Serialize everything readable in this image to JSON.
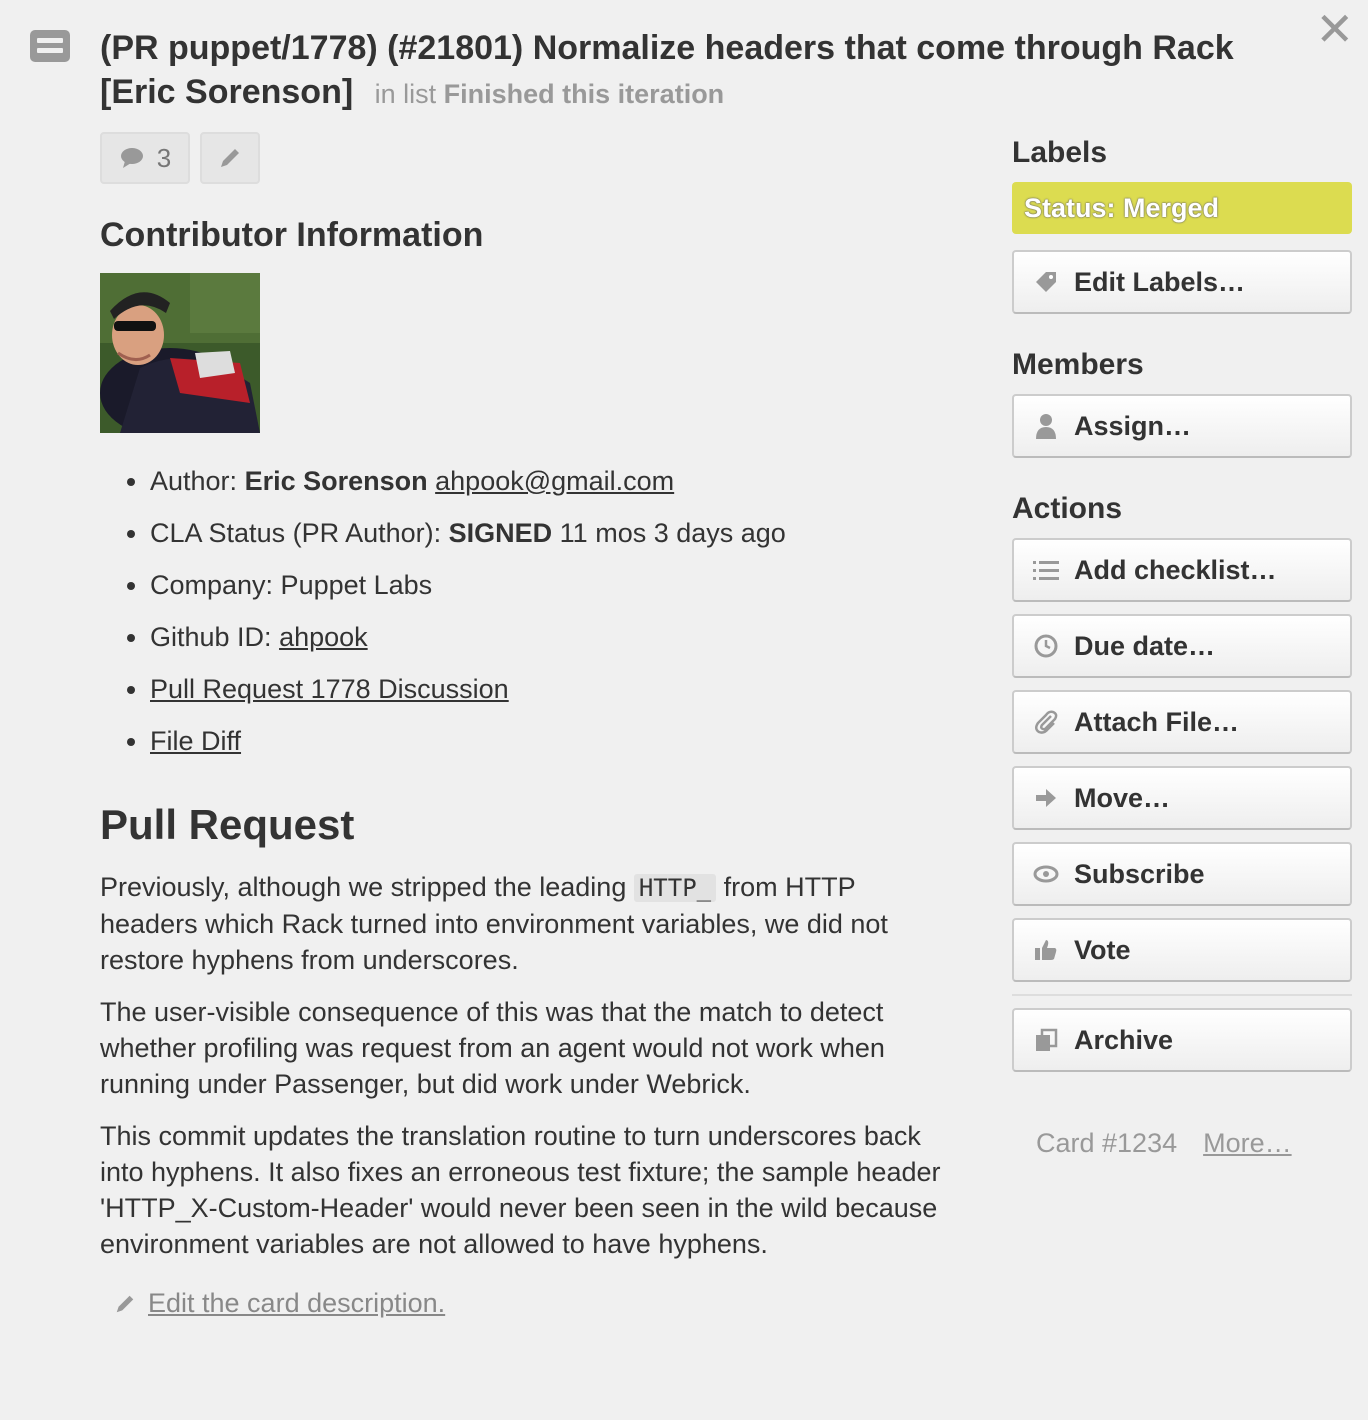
{
  "card": {
    "title": "(PR puppet/1778) (#21801) Normalize headers that come through Rack [Eric Sorenson]",
    "in_list_prefix": "in list",
    "list_name": "Finished this iteration",
    "comment_count": "3",
    "close_icon": "close-icon"
  },
  "contributor": {
    "heading": "Contributor Information",
    "items": [
      {
        "label": "Author: ",
        "bold": "Eric Sorenson",
        "link": "ahpook@gmail.com",
        "rest": ""
      },
      {
        "label": "CLA Status (PR Author): ",
        "bold": "SIGNED",
        "rest": " 11 mos 3 days ago"
      },
      {
        "label": "Company: Puppet Labs"
      },
      {
        "label": "Github ID: ",
        "link": "ahpook"
      },
      {
        "link": "Pull Request 1778 Discussion"
      },
      {
        "link": "File Diff"
      }
    ]
  },
  "pull_request": {
    "heading": "Pull Request",
    "p1_before": "Previously, although we stripped the leading ",
    "p1_code": "HTTP_",
    "p1_after": " from HTTP headers which Rack turned into environment variables, we did not restore hyphens from underscores.",
    "p2": "The user-visible consequence of this was that the match to detect whether profiling was request from an agent would not work when running under Passenger, but did work under Webrick.",
    "p3": "This commit updates the translation routine to turn underscores back into hyphens. It also fixes an erroneous test fixture; the sample header 'HTTP_X-Custom-Header' would never been seen in the wild because environment variables are not allowed to have hyphens.",
    "edit_link": "Edit the card description."
  },
  "sidebar": {
    "labels_heading": "Labels",
    "label_chip": "Status: Merged",
    "label_color": "#dcdc50",
    "edit_labels": "Edit Labels…",
    "members_heading": "Members",
    "assign": "Assign…",
    "actions_heading": "Actions",
    "actions": {
      "add_checklist": "Add checklist…",
      "due_date": "Due date…",
      "attach_file": "Attach File…",
      "move": "Move…",
      "subscribe": "Subscribe",
      "vote": "Vote",
      "archive": "Archive"
    },
    "card_number": "Card #1234",
    "more": "More…"
  }
}
